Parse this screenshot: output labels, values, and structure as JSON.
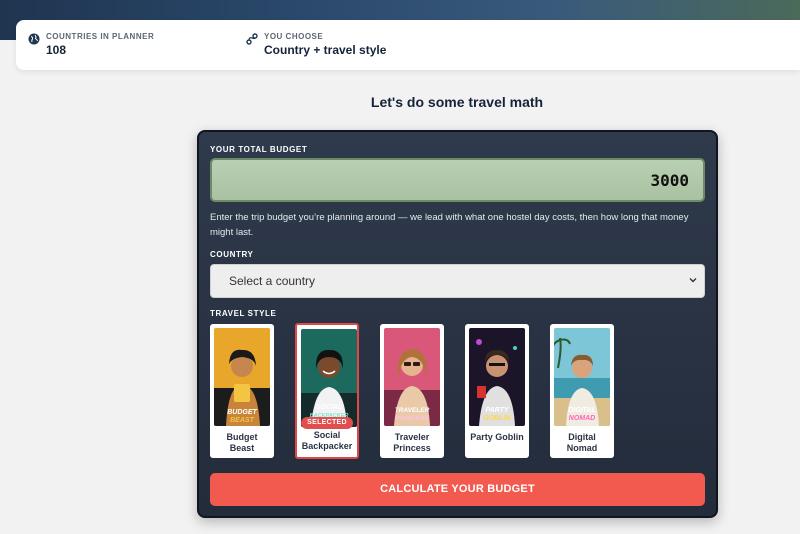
{
  "stats": [
    {
      "label": "COUNTRIES IN PLANNER",
      "value": "108",
      "icon": "globe-icon"
    },
    {
      "label": "YOU CHOOSE",
      "value": "Country + travel style",
      "icon": "route-icon"
    }
  ],
  "section_title": "Let's do some travel math",
  "form": {
    "budget_label": "YOUR TOTAL BUDGET",
    "budget_value": "3000",
    "budget_help": "Enter the trip budget you’re planning around — we lead with what one hostel day costs, then how long that money might last.",
    "country_label": "COUNTRY",
    "country_selected": "Select a country",
    "style_label": "TRAVEL STYLE",
    "styles": [
      {
        "name_line1": "Budget",
        "name_line2": "Beast",
        "poster_line1": "BUDGET",
        "poster_line2": "BEAST",
        "selected": false
      },
      {
        "name_line1": "Social",
        "name_line2": "Backpacker",
        "poster_line1": "SOCIAL",
        "poster_line2": "BACKPACKER",
        "selected": true,
        "badge": "SELECTED"
      },
      {
        "name_line1": "Traveler",
        "name_line2": "Princess",
        "poster_line1": "TRAVELER",
        "poster_line2": "PRINCESS",
        "selected": false
      },
      {
        "name_line1": "Party Goblin",
        "name_line2": "",
        "poster_line1": "PARTY",
        "poster_line2": "GOBLIN",
        "selected": false
      },
      {
        "name_line1": "Digital",
        "name_line2": "Nomad",
        "poster_line1": "DIGITAL",
        "poster_line2": "NOMAD",
        "selected": false
      }
    ],
    "submit_label": "CALCULATE YOUR BUDGET"
  },
  "colors": {
    "accent": "#f25a4f",
    "panel": "#2a3444",
    "budget_display": "#b3caab"
  }
}
